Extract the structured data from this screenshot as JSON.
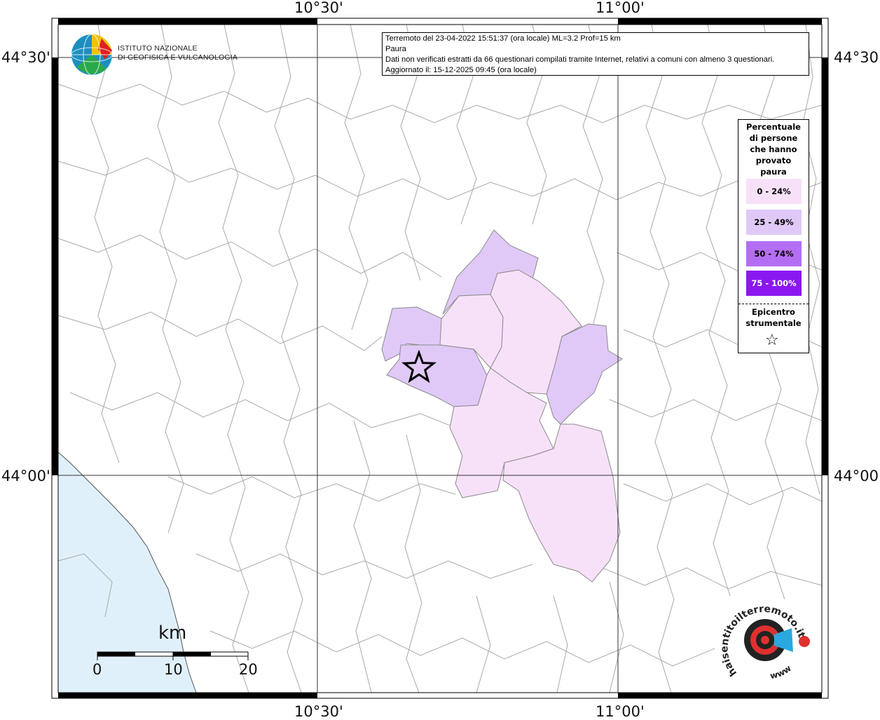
{
  "header": {
    "lon_labels": [
      "10°30'",
      "11°00'"
    ],
    "lat_labels": [
      "44°30'",
      "44°00'"
    ]
  },
  "info": {
    "line1": "Terremoto del 23-04-2022 15:51:37 (ora locale) ML=3.2 Prof=15 km",
    "line2": "Paura",
    "line3": "Dati non verificati estratti da 66 questionari compilati tramite Internet, relativi a comuni con almeno 3 questionari.",
    "line4": "Aggiornato il: 15-12-2025 09:45 (ora locale)"
  },
  "ingv_logo": {
    "line1": "ISTITUTO NAZIONALE",
    "line2": "DI GEOFISICA E VULCANOLOGIA"
  },
  "legend": {
    "title": [
      "Percentuale",
      "di persone",
      "che hanno",
      "provato",
      "paura"
    ],
    "classes": [
      {
        "label": "0 - 24%",
        "color": "#f7e1f9"
      },
      {
        "label": "25 - 49%",
        "color": "#e0c9f7"
      },
      {
        "label": "50 - 74%",
        "color": "#b46ef3"
      },
      {
        "label": "75 - 100%",
        "color": "#8a17f0"
      }
    ],
    "epicenter_title": [
      "Epicentro",
      "strumentale"
    ],
    "epicenter_symbol": "☆"
  },
  "scalebar": {
    "unit": "km",
    "ticks": [
      "0",
      "10",
      "20"
    ]
  },
  "hsit_logo": {
    "text": "haisentitoilterremoto.it",
    "sub": "www"
  },
  "colors": {
    "sea": "#e0f0fa",
    "border_lines": "#a0a0a0",
    "grid": "#333333"
  }
}
